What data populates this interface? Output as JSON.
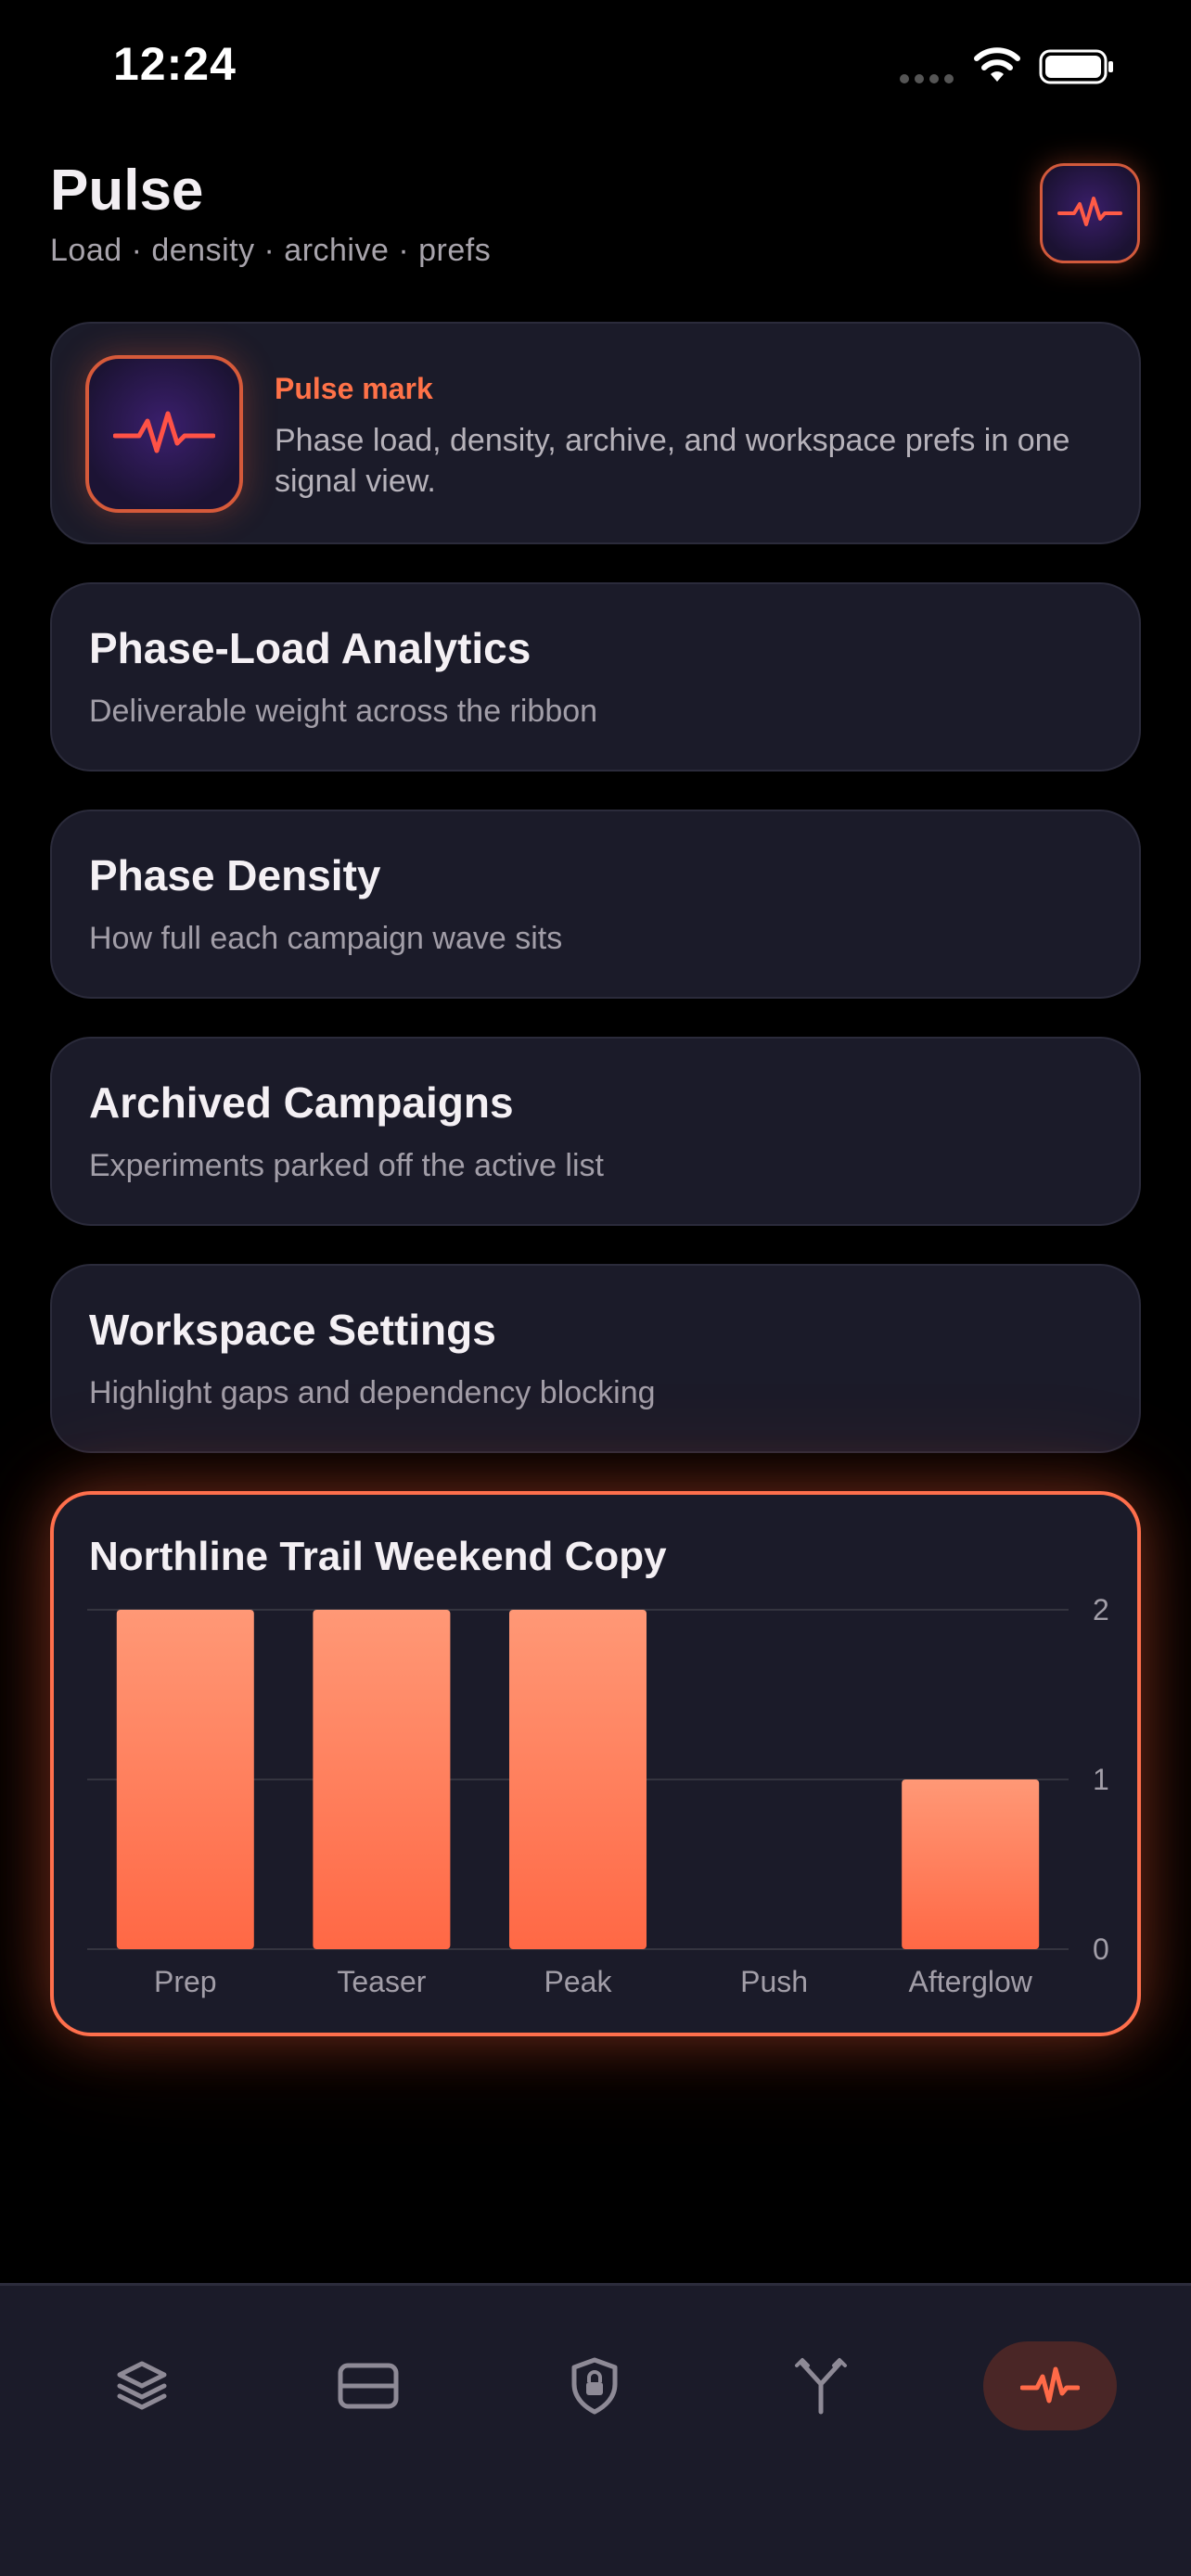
{
  "status": {
    "time": "12:24"
  },
  "header": {
    "title": "Pulse",
    "subtitle": "Load · density · archive · prefs"
  },
  "mark_card": {
    "title": "Pulse mark",
    "text": "Phase load, density, archive, and workspace prefs in one signal view."
  },
  "menu": [
    {
      "title": "Phase-Load Analytics",
      "subtitle": "Deliverable weight across the ribbon"
    },
    {
      "title": "Phase Density",
      "subtitle": "How full each campaign wave sits"
    },
    {
      "title": "Archived Campaigns",
      "subtitle": "Experiments parked off the active list"
    },
    {
      "title": "Workspace Settings",
      "subtitle": "Highlight gaps and dependency blocking"
    }
  ],
  "chart_data": {
    "type": "bar",
    "title": "Northline Trail Weekend Copy",
    "categories": [
      "Prep",
      "Teaser",
      "Peak",
      "Push",
      "Afterglow"
    ],
    "values": [
      2,
      2,
      2,
      0,
      1
    ],
    "ylim": [
      0,
      2
    ],
    "yticks": [
      "0",
      "1",
      "2"
    ],
    "grid": true,
    "bar_color": "#ff6f4c"
  },
  "tabs": [
    {
      "icon": "layers-icon",
      "active": false
    },
    {
      "icon": "card-icon",
      "active": false
    },
    {
      "icon": "shield-lock-icon",
      "active": false
    },
    {
      "icon": "branch-icon",
      "active": false
    },
    {
      "icon": "pulse-icon",
      "active": true
    }
  ],
  "colors": {
    "accent": "#ff6f4c",
    "background": "#000000",
    "card": "#1b1b29"
  }
}
